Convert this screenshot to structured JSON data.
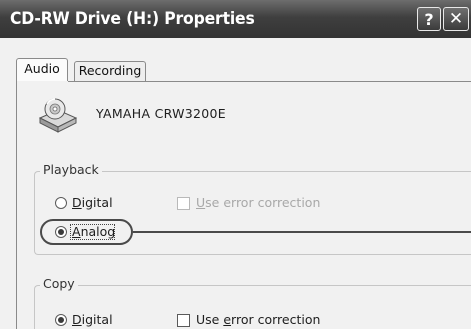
{
  "window": {
    "title": "CD-RW Drive (H:) Properties",
    "help_glyph": "?",
    "close_glyph": "✕"
  },
  "tabs": [
    {
      "label": "Audio",
      "active": true
    },
    {
      "label": "Recording",
      "active": false
    }
  ],
  "device": {
    "icon": "cd-drive-icon",
    "name": "YAMAHA  CRW3200E"
  },
  "playback": {
    "group_label": "Playback",
    "digital": {
      "pre": "",
      "key": "D",
      "post": "igital",
      "selected": false
    },
    "error_correction": {
      "pre": "",
      "key": "U",
      "post": "se error correction",
      "checked": false,
      "enabled": false
    },
    "analog": {
      "pre": "",
      "key": "A",
      "post": "nalog",
      "selected": true
    }
  },
  "copy": {
    "group_label": "Copy",
    "digital": {
      "pre": "",
      "key": "D",
      "post": "igital",
      "selected": true
    },
    "error_correction": {
      "pre": "Use ",
      "key": "e",
      "post": "rror correction",
      "checked": false,
      "enabled": true
    }
  },
  "colors": {
    "titlebar": "#3f3f3f",
    "background": "#f1f1f1",
    "disabled_text": "#a8a8a8"
  }
}
